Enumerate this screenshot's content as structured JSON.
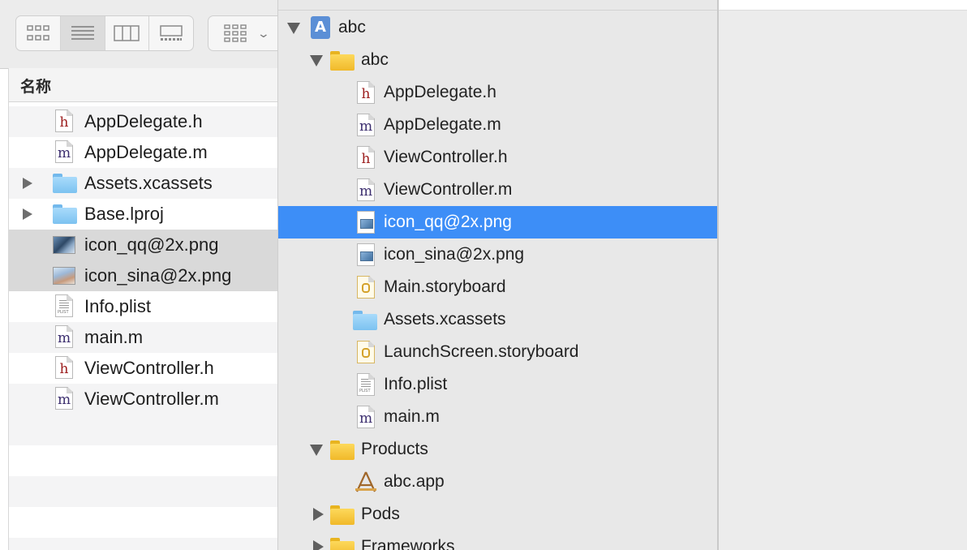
{
  "finder": {
    "column_header": "名称",
    "view_modes": [
      "icon-view",
      "list-view",
      "column-view",
      "gallery-view"
    ],
    "active_view": "list-view",
    "rows": [
      {
        "label": "AppDelegate.h",
        "icon": "h-file-icon",
        "expandable": false,
        "selected": false
      },
      {
        "label": "AppDelegate.m",
        "icon": "m-file-icon",
        "expandable": false,
        "selected": false
      },
      {
        "label": "Assets.xcassets",
        "icon": "blue-folder-icon",
        "expandable": true,
        "selected": false
      },
      {
        "label": "Base.lproj",
        "icon": "blue-folder-icon",
        "expandable": true,
        "selected": false
      },
      {
        "label": "icon_qq@2x.png",
        "icon": "image-thumbnail-icon",
        "expandable": false,
        "selected": true
      },
      {
        "label": "icon_sina@2x.png",
        "icon": "image-thumbnail-icon",
        "expandable": false,
        "selected": true
      },
      {
        "label": "Info.plist",
        "icon": "plist-file-icon",
        "expandable": false,
        "selected": false
      },
      {
        "label": "main.m",
        "icon": "m-file-icon",
        "expandable": false,
        "selected": false
      },
      {
        "label": "ViewController.h",
        "icon": "h-file-icon",
        "expandable": false,
        "selected": false
      },
      {
        "label": "ViewController.m",
        "icon": "m-file-icon",
        "expandable": false,
        "selected": false
      }
    ]
  },
  "navigator": {
    "selection_color": "#3d8ef7",
    "items": [
      {
        "label": "abc",
        "icon": "xcode-project-icon",
        "level": 0,
        "disclosure": "expanded"
      },
      {
        "label": "abc",
        "icon": "yellow-folder-icon",
        "level": 1,
        "disclosure": "expanded"
      },
      {
        "label": "AppDelegate.h",
        "icon": "h-file-icon",
        "level": 2,
        "disclosure": "none"
      },
      {
        "label": "AppDelegate.m",
        "icon": "m-file-icon",
        "level": 2,
        "disclosure": "none"
      },
      {
        "label": "ViewController.h",
        "icon": "h-file-icon",
        "level": 2,
        "disclosure": "none"
      },
      {
        "label": "ViewController.m",
        "icon": "m-file-icon",
        "level": 2,
        "disclosure": "none"
      },
      {
        "label": "icon_qq@2x.png",
        "icon": "png-file-icon",
        "level": 2,
        "disclosure": "none",
        "selected": true
      },
      {
        "label": "icon_sina@2x.png",
        "icon": "png-file-icon",
        "level": 2,
        "disclosure": "none"
      },
      {
        "label": "Main.storyboard",
        "icon": "storyboard-file-icon",
        "level": 2,
        "disclosure": "none"
      },
      {
        "label": "Assets.xcassets",
        "icon": "blue-folder-icon",
        "level": 2,
        "disclosure": "none"
      },
      {
        "label": "LaunchScreen.storyboard",
        "icon": "storyboard-file-icon",
        "level": 2,
        "disclosure": "none"
      },
      {
        "label": "Info.plist",
        "icon": "plist-file-icon",
        "level": 2,
        "disclosure": "none"
      },
      {
        "label": "main.m",
        "icon": "m-file-icon",
        "level": 2,
        "disclosure": "none"
      },
      {
        "label": "Products",
        "icon": "yellow-folder-icon",
        "level": 1,
        "disclosure": "expanded"
      },
      {
        "label": "abc.app",
        "icon": "app-icon",
        "level": 2,
        "disclosure": "none"
      },
      {
        "label": "Pods",
        "icon": "yellow-folder-icon",
        "level": 1,
        "disclosure": "collapsed"
      },
      {
        "label": "Frameworks",
        "icon": "yellow-folder-icon",
        "level": 1,
        "disclosure": "collapsed"
      }
    ]
  }
}
